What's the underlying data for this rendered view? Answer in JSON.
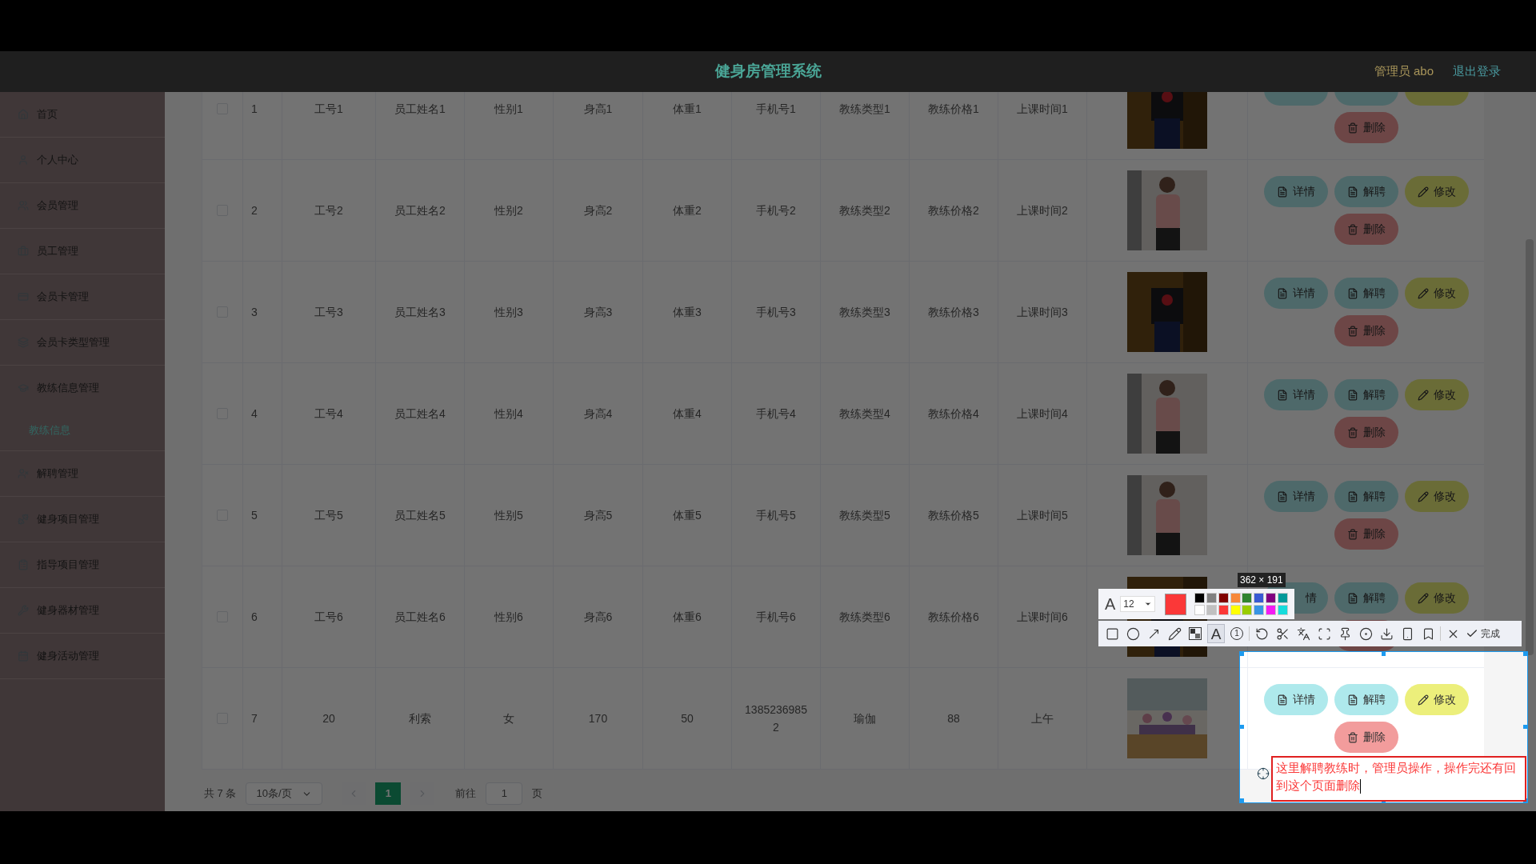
{
  "header": {
    "title": "健身房管理系统",
    "user": "管理员 abo",
    "logout": "退出登录"
  },
  "sidebar": {
    "items": [
      {
        "label": "首页",
        "selected": false
      },
      {
        "label": "个人中心",
        "selected": false
      },
      {
        "label": "会员管理",
        "selected": false
      },
      {
        "label": "员工管理",
        "selected": false
      },
      {
        "label": "会员卡管理",
        "selected": false
      },
      {
        "label": "会员卡类型管理",
        "selected": false
      },
      {
        "label": "教练信息管理",
        "selected": false,
        "children": [
          {
            "label": "教练信息",
            "selected": true
          }
        ]
      },
      {
        "label": "解聘管理",
        "selected": false
      },
      {
        "label": "健身项目管理",
        "selected": false
      },
      {
        "label": "指导项目管理",
        "selected": false
      },
      {
        "label": "健身器材管理",
        "selected": false
      },
      {
        "label": "健身活动管理",
        "selected": false
      }
    ]
  },
  "table": {
    "rows": [
      {
        "checked": false,
        "cells": [
          "1",
          "工号1",
          "员工姓名1",
          "性别1",
          "身高1",
          "体重1",
          "手机号1",
          "教练类型1",
          "教练价格1",
          "上课时间1"
        ],
        "actions": [
          {
            "kind": "detail"
          },
          {
            "kind": "dismiss"
          },
          {
            "kind": "edit"
          },
          {
            "kind": "delete",
            "label": "删除"
          }
        ]
      },
      {
        "checked": false,
        "cells": [
          "2",
          "工号2",
          "员工姓名2",
          "性别2",
          "身高2",
          "体重2",
          "手机号2",
          "教练类型2",
          "教练价格2",
          "上课时间2"
        ],
        "actions": [
          {
            "kind": "detail",
            "label": "详情"
          },
          {
            "kind": "dismiss",
            "label": "解聘"
          },
          {
            "kind": "edit",
            "label": "修改"
          },
          {
            "kind": "delete",
            "label": "删除"
          }
        ]
      },
      {
        "checked": false,
        "cells": [
          "3",
          "工号3",
          "员工姓名3",
          "性别3",
          "身高3",
          "体重3",
          "手机号3",
          "教练类型3",
          "教练价格3",
          "上课时间3"
        ],
        "actions": [
          {
            "kind": "detail",
            "label": "详情"
          },
          {
            "kind": "dismiss",
            "label": "解聘"
          },
          {
            "kind": "edit",
            "label": "修改"
          },
          {
            "kind": "delete",
            "label": "删除"
          }
        ]
      },
      {
        "checked": false,
        "cells": [
          "4",
          "工号4",
          "员工姓名4",
          "性别4",
          "身高4",
          "体重4",
          "手机号4",
          "教练类型4",
          "教练价格4",
          "上课时间4"
        ],
        "actions": [
          {
            "kind": "detail",
            "label": "详情"
          },
          {
            "kind": "dismiss",
            "label": "解聘"
          },
          {
            "kind": "edit",
            "label": "修改"
          },
          {
            "kind": "delete",
            "label": "删除"
          }
        ]
      },
      {
        "checked": false,
        "cells": [
          "5",
          "工号5",
          "员工姓名5",
          "性别5",
          "身高5",
          "体重5",
          "手机号5",
          "教练类型5",
          "教练价格5",
          "上课时间5"
        ],
        "actions": [
          {
            "kind": "detail",
            "label": "详情"
          },
          {
            "kind": "dismiss",
            "label": "解聘"
          },
          {
            "kind": "edit",
            "label": "修改"
          },
          {
            "kind": "delete",
            "label": "删除"
          }
        ]
      },
      {
        "checked": false,
        "cells": [
          "6",
          "工号6",
          "员工姓名6",
          "性别6",
          "身高6",
          "体重6",
          "手机号6",
          "教练类型6",
          "教练价格6",
          "上课时间6"
        ],
        "actions": [
          {
            "kind": "detail",
            "label": "情",
            "icon": false
          },
          {
            "kind": "dismiss",
            "label": "解聘"
          },
          {
            "kind": "edit",
            "label": "修改"
          },
          {
            "kind": "delete"
          }
        ]
      },
      {
        "checked": false,
        "cells": [
          "7",
          "20",
          "利索",
          "女",
          "170",
          "50",
          "13852369852",
          "瑜伽",
          "88",
          "上午"
        ],
        "actions": [
          {
            "kind": "detail",
            "label": "详情"
          },
          {
            "kind": "dismiss",
            "label": "解聘"
          },
          {
            "kind": "edit",
            "label": "修改"
          },
          {
            "kind": "delete",
            "label": "删除"
          }
        ]
      }
    ]
  },
  "pagination": {
    "total": "共 7 条",
    "page_size": "10条/页",
    "pages": [
      {
        "label": "1",
        "selected": true
      }
    ],
    "goto_label": "前往",
    "goto_value": "1",
    "goto_suffix": "页"
  },
  "capture_tool": {
    "size_label": "362 × 191",
    "font_icon": "A",
    "font_size": "12",
    "current": {
      "color": "#fb3838"
    },
    "palette": [
      {
        "color": "#000000"
      },
      {
        "color": "#808080"
      },
      {
        "color": "#800000"
      },
      {
        "color": "#f7883a"
      },
      {
        "color": "#308430"
      },
      {
        "color": "#385ad3"
      },
      {
        "color": "#800080"
      },
      {
        "color": "#009999"
      },
      {
        "color": "#ffffff"
      },
      {
        "color": "#c0c0c0"
      },
      {
        "color": "#fb3838"
      },
      {
        "color": "#ffff00"
      },
      {
        "color": "#99cc00"
      },
      {
        "color": "#3894e4"
      },
      {
        "color": "#f31bf3"
      },
      {
        "color": "#16dcdc"
      }
    ],
    "tools": [
      {
        "kind": "rectangle",
        "selected": false
      },
      {
        "kind": "ellipse",
        "selected": false
      },
      {
        "kind": "arrow",
        "selected": false
      },
      {
        "kind": "pencil",
        "selected": false
      },
      {
        "kind": "mosaic",
        "selected": false
      },
      {
        "kind": "text",
        "label": "A",
        "selected": true
      },
      {
        "kind": "number",
        "label": "1",
        "selected": false
      },
      {
        "kind": "separator"
      },
      {
        "kind": "undo",
        "selected": false
      },
      {
        "kind": "cut",
        "selected": false
      },
      {
        "kind": "translate",
        "selected": false
      },
      {
        "kind": "scan",
        "selected": false
      },
      {
        "kind": "pin",
        "selected": false
      },
      {
        "kind": "record",
        "selected": false
      },
      {
        "kind": "download",
        "selected": false
      },
      {
        "kind": "phone",
        "selected": false
      },
      {
        "kind": "bookmark",
        "selected": false
      },
      {
        "kind": "separator"
      },
      {
        "kind": "close",
        "selected": false
      },
      {
        "kind": "finish",
        "label": "完成",
        "selected": false
      }
    ],
    "annotation": "这里解聘教练时，管理员操作，操作完还有回到这个页面删除"
  }
}
